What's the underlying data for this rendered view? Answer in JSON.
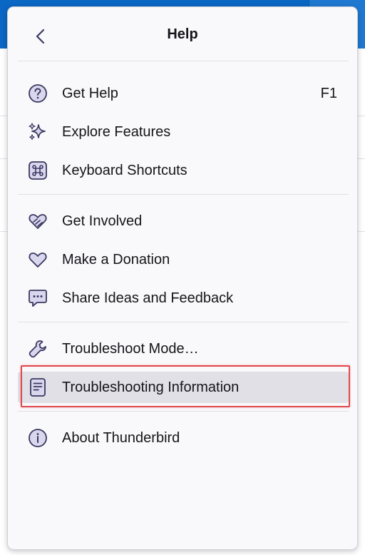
{
  "header": {
    "title": "Help"
  },
  "menu": {
    "get_help": {
      "label": "Get Help",
      "accel": "F1",
      "icon": "help-circle-icon"
    },
    "explore_features": {
      "label": "Explore Features",
      "icon": "sparkles-icon"
    },
    "keyboard_shortcuts": {
      "label": "Keyboard Shortcuts",
      "icon": "command-key-icon"
    },
    "get_involved": {
      "label": "Get Involved",
      "icon": "heart-hands-icon"
    },
    "make_donation": {
      "label": "Make a Donation",
      "icon": "heart-icon"
    },
    "share_ideas": {
      "label": "Share Ideas and Feedback",
      "icon": "chat-bubble-icon"
    },
    "troubleshoot_mode": {
      "label": "Troubleshoot Mode…",
      "icon": "wrench-icon"
    },
    "troubleshooting_info": {
      "label": "Troubleshooting Information",
      "icon": "document-icon"
    },
    "about": {
      "label": "About Thunderbird",
      "icon": "info-circle-icon"
    }
  },
  "colors": {
    "highlight_border": "#e0474e",
    "icon_stroke": "#3a3860",
    "icon_fill": "#d9d6ee"
  }
}
